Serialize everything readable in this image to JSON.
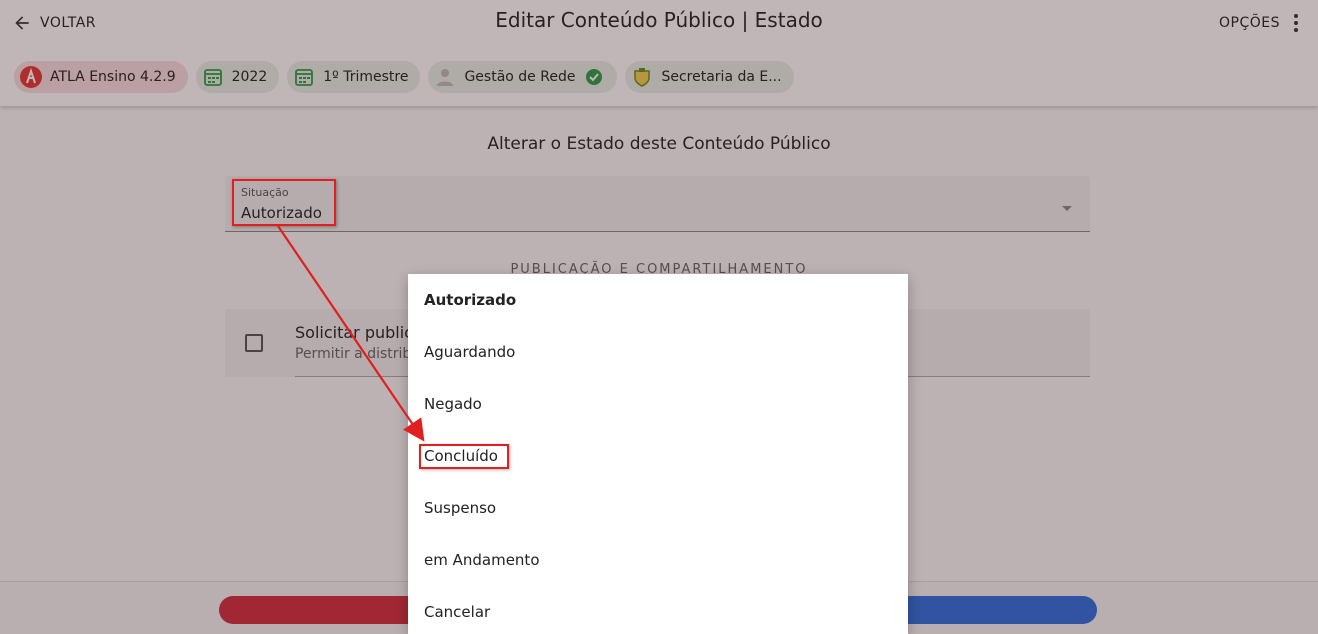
{
  "header": {
    "back_label": "VOLTAR",
    "title": "Editar Conteúdo Público | Estado",
    "options_label": "OPÇÕES"
  },
  "chips": [
    {
      "label": "ATLA Ensino 4.2.9",
      "icon": "atla-logo-icon"
    },
    {
      "label": "2022",
      "icon": "calendar-icon"
    },
    {
      "label": "1º Trimestre",
      "icon": "calendar-icon"
    },
    {
      "label": "Gestão de Rede",
      "icon": "user-icon"
    },
    {
      "label": "Secretaria da E...",
      "icon": "crest-icon"
    }
  ],
  "main": {
    "section_title": "Alterar o Estado deste Conteúdo Público",
    "select": {
      "label": "Situação",
      "value": "Autorizado"
    },
    "subheader": "PUBLICAÇÃO E COMPARTILHAMENTO",
    "checkbox": {
      "title": "Solicitar public",
      "subtitle": "Permitir a distrib"
    }
  },
  "menu": {
    "items": [
      "Autorizado",
      "Aguardando",
      "Negado",
      "Concluído",
      "Suspenso",
      "em Andamento",
      "Cancelar"
    ],
    "selected": "Autorizado",
    "highlighted": "Concluído"
  },
  "colors": {
    "accent_red": "#d32f3f",
    "accent_blue": "#2f6fe0",
    "annotation_red": "#e02020",
    "status_green": "#2e9e4a"
  }
}
